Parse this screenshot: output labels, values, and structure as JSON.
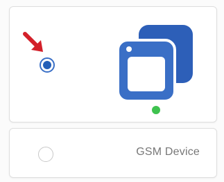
{
  "selector": {
    "options": [
      {
        "label": "",
        "selected": true,
        "icon": "window-stack-icon",
        "status": "online",
        "status_color": "#3ec24f"
      },
      {
        "label": "GSM Device",
        "selected": false
      }
    ]
  },
  "annotation": {
    "pointer": "red-arrow-icon",
    "color": "#d3202a"
  },
  "colors": {
    "accent": "#245fb8",
    "icon_blue": "#3a6fc6"
  }
}
